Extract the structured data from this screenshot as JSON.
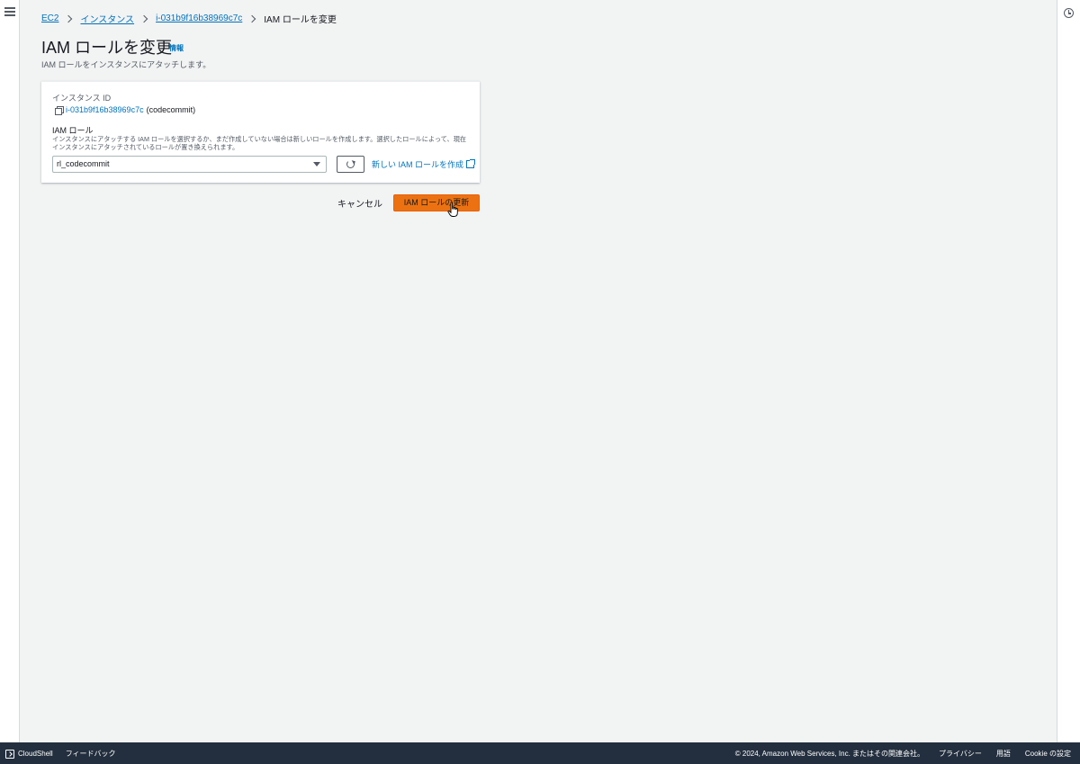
{
  "breadcrumb": {
    "items": [
      "EC2",
      "インスタンス",
      "i-031b9f16b38969c7c"
    ],
    "current": "IAM ロールを変更"
  },
  "page": {
    "title": "IAM ロールを変更",
    "info": "情報",
    "description": "IAM ロールをインスタンスにアタッチします。"
  },
  "form": {
    "instance_id_label": "インスタンス ID",
    "instance_id": "i-031b9f16b38969c7c",
    "instance_name": "(codecommit)",
    "iam_role_label": "IAM ロール",
    "iam_role_description": "インスタンスにアタッチする IAM ロールを選択するか、まだ作成していない場合は新しいロールを作成します。選択したロールによって、現在インスタンスにアタッチされているロールが置き換えられます。",
    "selected_role": "rl_codecommit",
    "create_role_link": "新しい IAM ロールを作成"
  },
  "actions": {
    "cancel": "キャンセル",
    "update": "IAM ロールの更新"
  },
  "footer": {
    "cloudshell": "CloudShell",
    "feedback": "フィードバック",
    "copyright": "© 2024, Amazon Web Services, Inc. またはその関連会社。",
    "privacy": "プライバシー",
    "terms": "用語",
    "cookies": "Cookie の設定"
  },
  "colors": {
    "primary_button": "#ec7211",
    "link": "#0073bb",
    "footer_bg": "#232f3e"
  }
}
